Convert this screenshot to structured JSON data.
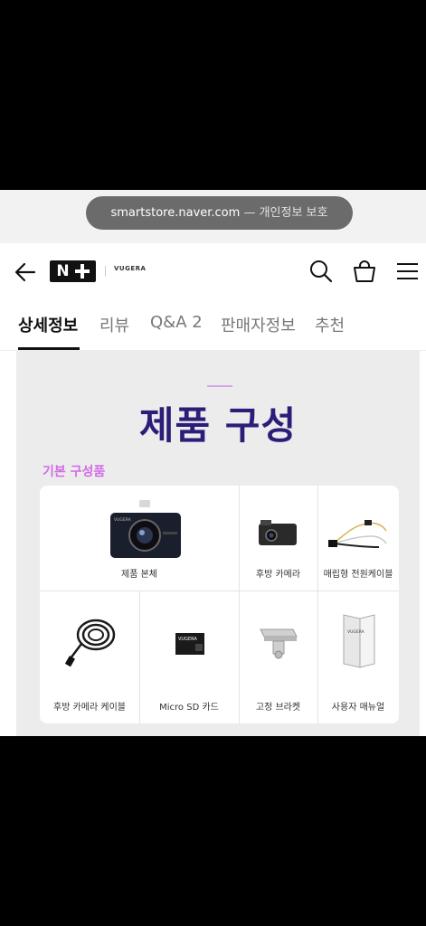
{
  "url_bar": {
    "domain": "smartstore.naver.com",
    "note": "— 개인정보 보호"
  },
  "header": {
    "logo_text": "N",
    "brand": "VUGERA",
    "icons": [
      "back-arrow-icon",
      "search-icon",
      "shopping-bag-icon",
      "hamburger-menu-icon"
    ]
  },
  "tabs": [
    {
      "label": "상세정보",
      "active": true
    },
    {
      "label": "리뷰"
    },
    {
      "label": "Q&A 2"
    },
    {
      "label": "판매자정보"
    },
    {
      "label": "추천"
    }
  ],
  "content": {
    "title": "제품 구성",
    "subtitle": "기본 구성품",
    "items": [
      {
        "label": "제품 본체"
      },
      {
        "label": "후방 카메라"
      },
      {
        "label": "매립형 전원케이블"
      },
      {
        "label": "후방 카메라 케이블"
      },
      {
        "label": "Micro SD 카드"
      },
      {
        "label": "고정 브라켓"
      },
      {
        "label": "사용자 매뉴얼"
      }
    ]
  },
  "colors": {
    "title": "#2b1d78",
    "subtitle": "#d26ce6",
    "accent_line": "#d7a6e8",
    "background": "#ececec"
  }
}
